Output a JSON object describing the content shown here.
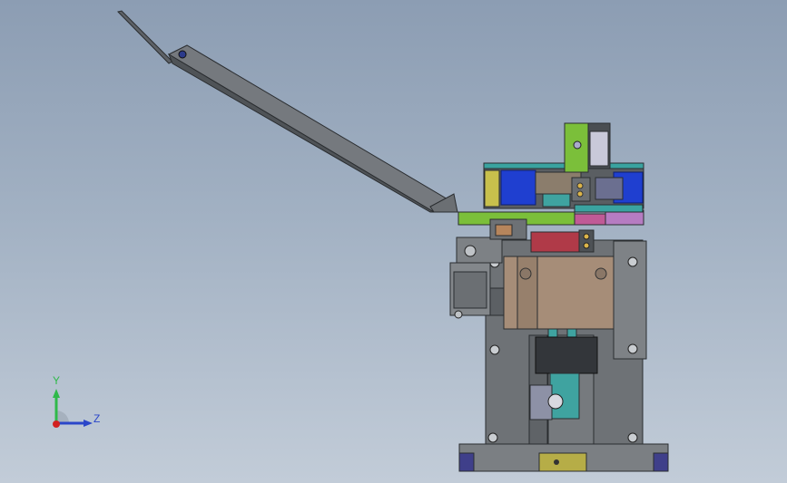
{
  "viewport": {
    "background_top": "#8c9db3",
    "background_bottom": "#c2ccd8"
  },
  "triad": {
    "y_label": "Y",
    "z_label": "Z",
    "y_color": "#2fb94a",
    "z_color": "#2b46c9",
    "x_color": "#d22020"
  },
  "colors": {
    "frame_gray": "#6e7276",
    "outline": "#2a2d30",
    "green_part": "#7bbf3a",
    "blue_roller": "#1f3fd0",
    "magenta_part": "#c05a96",
    "red_block": "#b03a48",
    "tan_block": "#a68d78",
    "teal_part": "#3fa3a0",
    "olive_plate": "#b6ad47",
    "navy_foot": "#3f3f8a"
  }
}
